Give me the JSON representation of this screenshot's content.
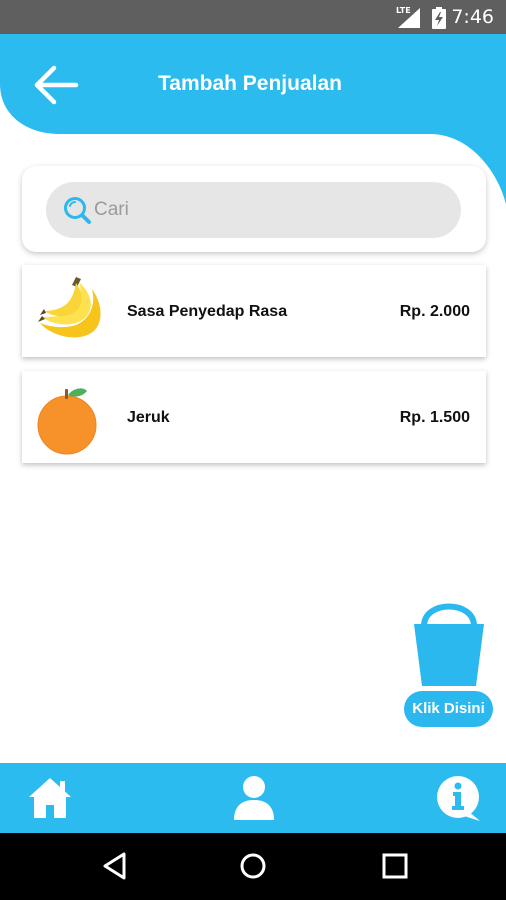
{
  "status_bar": {
    "network": "LTE",
    "time": "7:46"
  },
  "header": {
    "title": "Tambah Penjualan",
    "back_icon": "arrow-left-icon"
  },
  "search": {
    "placeholder": "Cari",
    "value": "",
    "icon": "search-icon"
  },
  "products": [
    {
      "name": "Sasa Penyedap Rasa",
      "price": "Rp. 2.000",
      "image": "banana-icon"
    },
    {
      "name": "Jeruk",
      "price": "Rp. 1.500",
      "image": "orange-icon"
    }
  ],
  "cart": {
    "label": "Klik Disini",
    "icon": "basket-icon"
  },
  "bottom_nav": {
    "items": [
      "home-icon",
      "user-icon",
      "info-icon"
    ]
  },
  "colors": {
    "primary": "#2bbbef",
    "status_bar": "#5f5f5f",
    "search_bg": "#e6e6e6"
  }
}
